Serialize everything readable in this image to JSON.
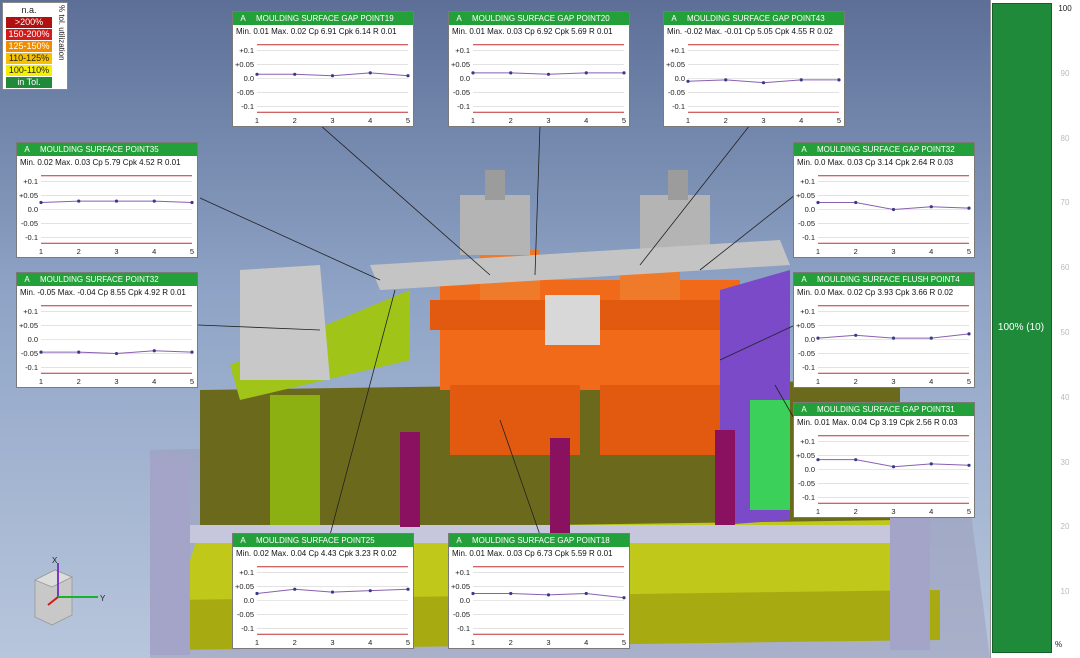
{
  "legend": {
    "rows": [
      {
        "label": "n.a.",
        "color": "#ffffff",
        "text_color": "#222222"
      },
      {
        "label": ">200%",
        "color": "#b01010",
        "text_color": "#ffffff"
      },
      {
        "label": "150-200%",
        "color": "#d21c1c",
        "text_color": "#ffffff"
      },
      {
        "label": "125-150%",
        "color": "#f08c00",
        "text_color": "#ffffff"
      },
      {
        "label": "110-125%",
        "color": "#f6c200",
        "text_color": "#222222"
      },
      {
        "label": "100-110%",
        "color": "#f4f000",
        "text_color": "#222222"
      },
      {
        "label": "in Tol.",
        "color": "#1f8a3a",
        "text_color": "#ffffff"
      }
    ],
    "vertical_label": "% tol. utilization"
  },
  "tolerance_chart_common": {
    "y_ticks": [
      "+0.1",
      "+0.05",
      "0.0",
      "-0.05",
      "-0.1"
    ],
    "y_tick_values": [
      0.1,
      0.05,
      0.0,
      -0.05,
      -0.1
    ],
    "x_ticks": [
      "1",
      "2",
      "3",
      "4",
      "5"
    ],
    "ylim": [
      -0.13,
      0.13
    ],
    "limit_color": "#c03030",
    "grid_color": "#d0d0d0",
    "series_color": "#8a5fb0"
  },
  "panels": [
    {
      "tag": "A",
      "title": "MOULDING SURFACE GAP POINT19",
      "stats": "Min. 0.01  Max. 0.02  Cp 6.91  Cpk 6.14  R 0.01",
      "values": [
        0.015,
        0.015,
        0.01,
        0.02,
        0.01
      ]
    },
    {
      "tag": "A",
      "title": "MOULDING SURFACE GAP POINT20",
      "stats": "Min. 0.01  Max. 0.03  Cp 6.92  Cpk 5.69  R 0.01",
      "values": [
        0.02,
        0.02,
        0.015,
        0.02,
        0.02
      ]
    },
    {
      "tag": "A",
      "title": "MOULDING SURFACE GAP POINT43",
      "stats": "Min. -0.02  Max. -0.01  Cp 5.05  Cpk 4.55  R 0.02",
      "values": [
        -0.01,
        -0.005,
        -0.015,
        -0.005,
        -0.005
      ]
    },
    {
      "tag": "A",
      "title": "MOULDING SURFACE POINT35",
      "stats": "Min. 0.02  Max. 0.03  Cp 5.79  Cpk 4.52  R 0.01",
      "values": [
        0.025,
        0.03,
        0.03,
        0.03,
        0.025
      ]
    },
    {
      "tag": "A",
      "title": "MOULDING SURFACE GAP POINT32",
      "stats": "Min. 0.0  Max. 0.03  Cp 3.14  Cpk 2.64  R 0.03",
      "values": [
        0.025,
        0.025,
        0.0,
        0.01,
        0.005
      ]
    },
    {
      "tag": "A",
      "title": "MOULDING SURFACE POINT32",
      "stats": "Min. -0.05  Max. -0.04  Cp 8.55  Cpk 4.92  R 0.01",
      "values": [
        -0.045,
        -0.045,
        -0.05,
        -0.04,
        -0.045
      ]
    },
    {
      "tag": "A",
      "title": "MOULDING SURFACE FLUSH POINT4",
      "stats": "Min. 0.0  Max. 0.02  Cp 3.93  Cpk 3.66  R 0.02",
      "values": [
        0.005,
        0.015,
        0.005,
        0.005,
        0.02
      ]
    },
    {
      "tag": "A",
      "title": "MOULDING SURFACE GAP POINT31",
      "stats": "Min. 0.01  Max. 0.04  Cp 3.19  Cpk 2.56  R 0.03",
      "values": [
        0.035,
        0.035,
        0.01,
        0.02,
        0.015
      ]
    },
    {
      "tag": "A",
      "title": "MOULDING SURFACE POINT25",
      "stats": "Min. 0.02  Max. 0.04  Cp 4.43  Cpk 3.23  R 0.02",
      "values": [
        0.025,
        0.04,
        0.03,
        0.035,
        0.04
      ]
    },
    {
      "tag": "A",
      "title": "MOULDING SURFACE GAP POINT18",
      "stats": "Min. 0.01  Max. 0.03  Cp 6.73  Cpk 5.59  R 0.01",
      "values": [
        0.025,
        0.025,
        0.02,
        0.025,
        0.01
      ]
    }
  ],
  "utilization_bar": {
    "label": "100% (10)",
    "fill_fraction": 1.0,
    "fill_color": "#1f8a3a",
    "scale_ticks": [
      "100",
      "90",
      "80",
      "70",
      "60",
      "50",
      "40",
      "30",
      "20",
      "10"
    ],
    "unit": "%"
  },
  "axis_triad": {
    "x": "X",
    "y": "Y"
  }
}
